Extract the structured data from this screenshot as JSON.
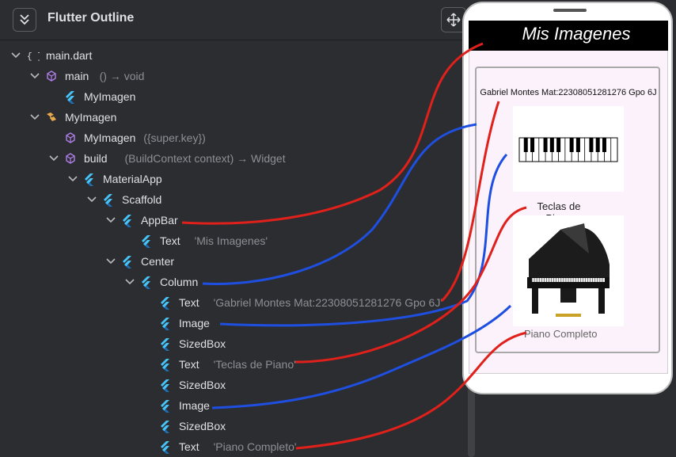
{
  "panel": {
    "title": "Flutter Outline"
  },
  "tree": [
    {
      "label": "main.dart",
      "detail": "",
      "icon": "braces-icon",
      "name": "tree-item-main-dart"
    },
    {
      "label": "main",
      "detail": "() → void",
      "icon": "cube-icon",
      "name": "tree-item-main"
    },
    {
      "label": "MyImagen",
      "detail": "",
      "icon": "flutter-icon",
      "name": "tree-item-myimagen-call"
    },
    {
      "label": "MyImagen",
      "detail": "",
      "icon": "class-icon",
      "name": "tree-item-myimagen-class"
    },
    {
      "label": "MyImagen",
      "detail": "({super.key})",
      "icon": "cube-icon",
      "name": "tree-item-constructor"
    },
    {
      "label": "build",
      "detail": "(BuildContext context) → Widget",
      "icon": "cube-icon",
      "name": "tree-item-build"
    },
    {
      "label": "MaterialApp",
      "detail": "",
      "icon": "flutter-icon",
      "name": "tree-item-materialapp"
    },
    {
      "label": "Scaffold",
      "detail": "",
      "icon": "flutter-icon",
      "name": "tree-item-scaffold"
    },
    {
      "label": "AppBar",
      "detail": "",
      "icon": "flutter-icon",
      "name": "tree-item-appbar"
    },
    {
      "label": "Text",
      "detail": "'Mis Imagenes'",
      "icon": "flutter-icon",
      "name": "tree-item-text-title"
    },
    {
      "label": "Center",
      "detail": "",
      "icon": "flutter-icon",
      "name": "tree-item-center"
    },
    {
      "label": "Column",
      "detail": "",
      "icon": "flutter-icon",
      "name": "tree-item-column"
    },
    {
      "label": "Text",
      "detail": "'Gabriel Montes Mat:22308051281276 Gpo 6J'",
      "icon": "flutter-icon",
      "name": "tree-item-text-gabriel"
    },
    {
      "label": "Image",
      "detail": "",
      "icon": "flutter-icon",
      "name": "tree-item-image-1"
    },
    {
      "label": "SizedBox",
      "detail": "",
      "icon": "flutter-icon",
      "name": "tree-item-sizedbox-1"
    },
    {
      "label": "Text",
      "detail": "'Teclas de Piano'",
      "icon": "flutter-icon",
      "name": "tree-item-text-teclas"
    },
    {
      "label": "SizedBox",
      "detail": "",
      "icon": "flutter-icon",
      "name": "tree-item-sizedbox-2"
    },
    {
      "label": "Image",
      "detail": "",
      "icon": "flutter-icon",
      "name": "tree-item-image-2"
    },
    {
      "label": "SizedBox",
      "detail": "",
      "icon": "flutter-icon",
      "name": "tree-item-sizedbox-3"
    },
    {
      "label": "Text",
      "detail": "'Piano Completo'",
      "icon": "flutter-icon",
      "name": "tree-item-text-piano"
    }
  ],
  "phone": {
    "appbar_title": "Mis Imagenes",
    "text1": "Gabriel Montes Mat:22308051281276 Gpo 6J",
    "text2": "Teclas de Piano",
    "text3": "Piano Completo"
  },
  "colors": {
    "annotation_red": "#e0201b",
    "annotation_blue": "#1f4fe0",
    "flutter_blue": "#47c5fb",
    "cube_purple": "#b07ee8"
  }
}
